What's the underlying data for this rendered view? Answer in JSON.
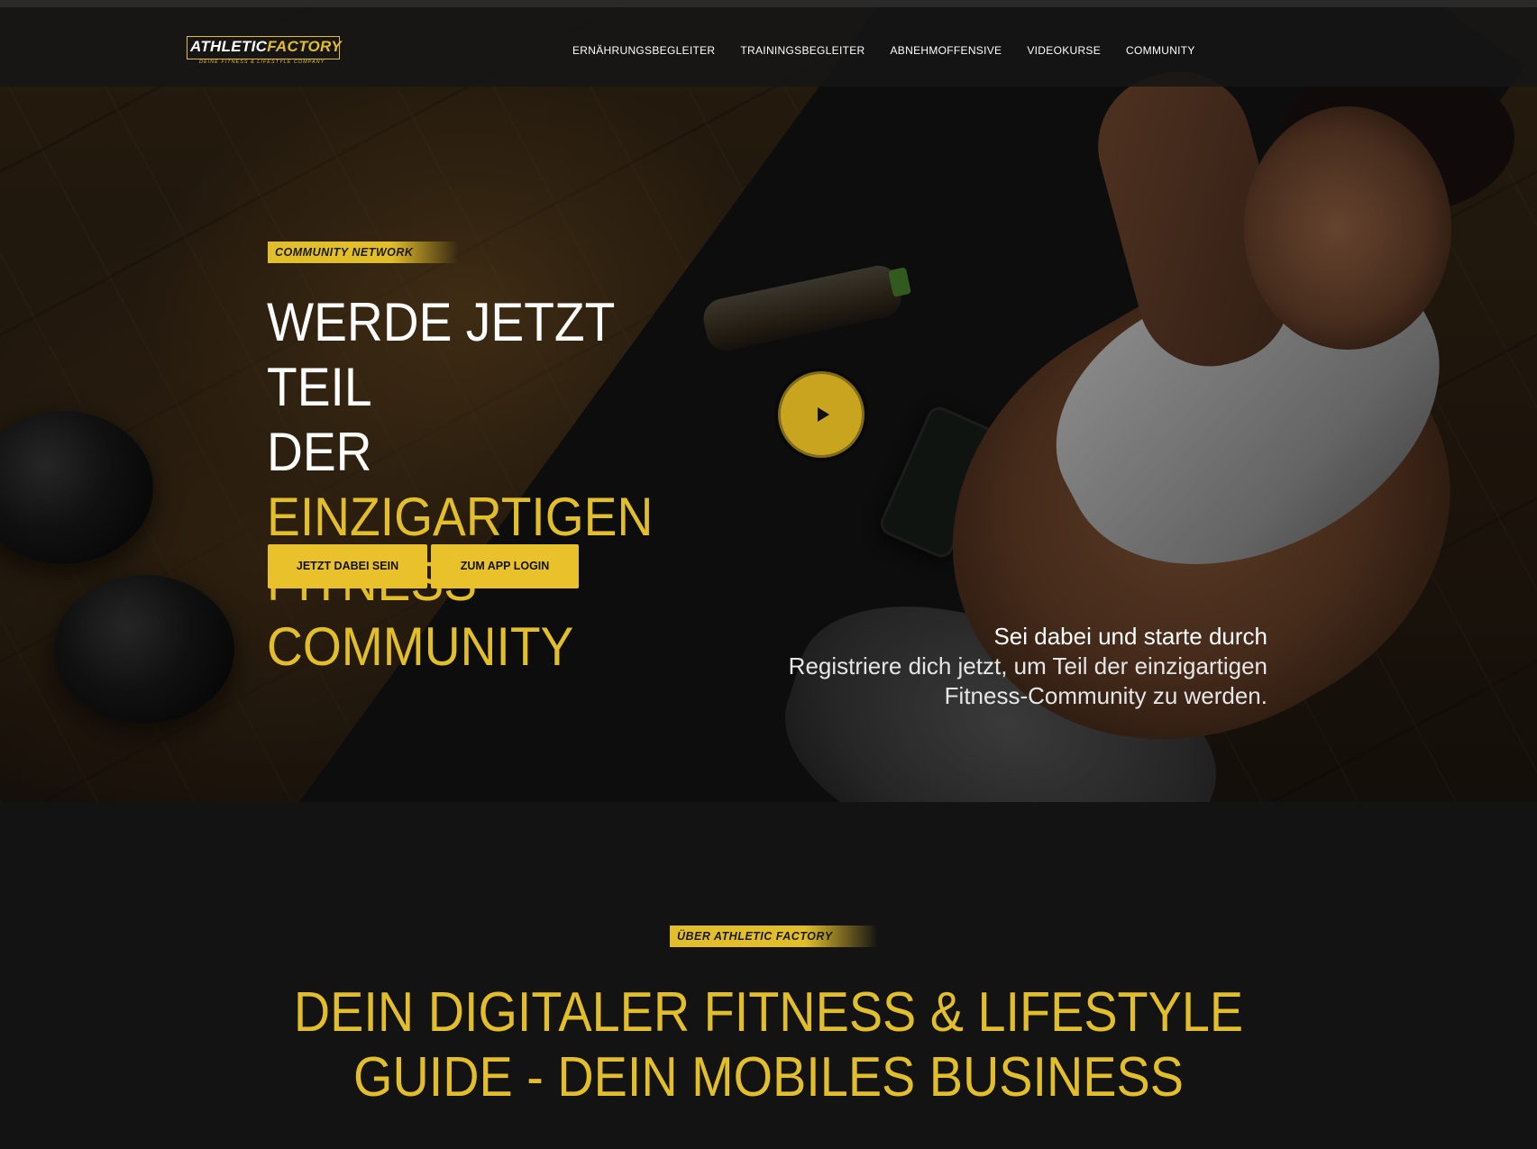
{
  "brand": {
    "name_part1": "ATHLETIC",
    "name_part2": "FACTORY",
    "tagline": "DEINE FITNESS & LIFESTYLE COMPANY",
    "accent_color": "#e2be2a"
  },
  "nav": {
    "items": [
      "ERNÄHRUNGSBEGLEITER",
      "TRAININGSBEGLEITER",
      "ABNEHMOFFENSIVE",
      "VIDEOKURSE",
      "COMMUNITY"
    ]
  },
  "hero": {
    "kicker": "COMMUNITY NETWORK",
    "title_line1": "WERDE JETZT TEIL",
    "title_line2_plain": "DER ",
    "title_line2_highlight": "EINZIGARTIGEN",
    "title_line3_highlight": "FITNESS COMMUNITY",
    "play_icon": "play-icon",
    "buttons": {
      "join": "JETZT DABEI SEIN",
      "login": "ZUM APP LOGIN"
    },
    "subtitle_lead": "Sei dabei und starte durch",
    "subtitle_body": "Registriere dich jetzt, um Teil der einzigartigen Fitness-Community zu werden."
  },
  "about": {
    "kicker": "ÜBER ATHLETIC FACTORY",
    "title_line1": "DEIN DIGITALER FITNESS & LIFESTYLE",
    "title_line2": "GUIDE - DEIN MOBILES BUSINESS"
  }
}
